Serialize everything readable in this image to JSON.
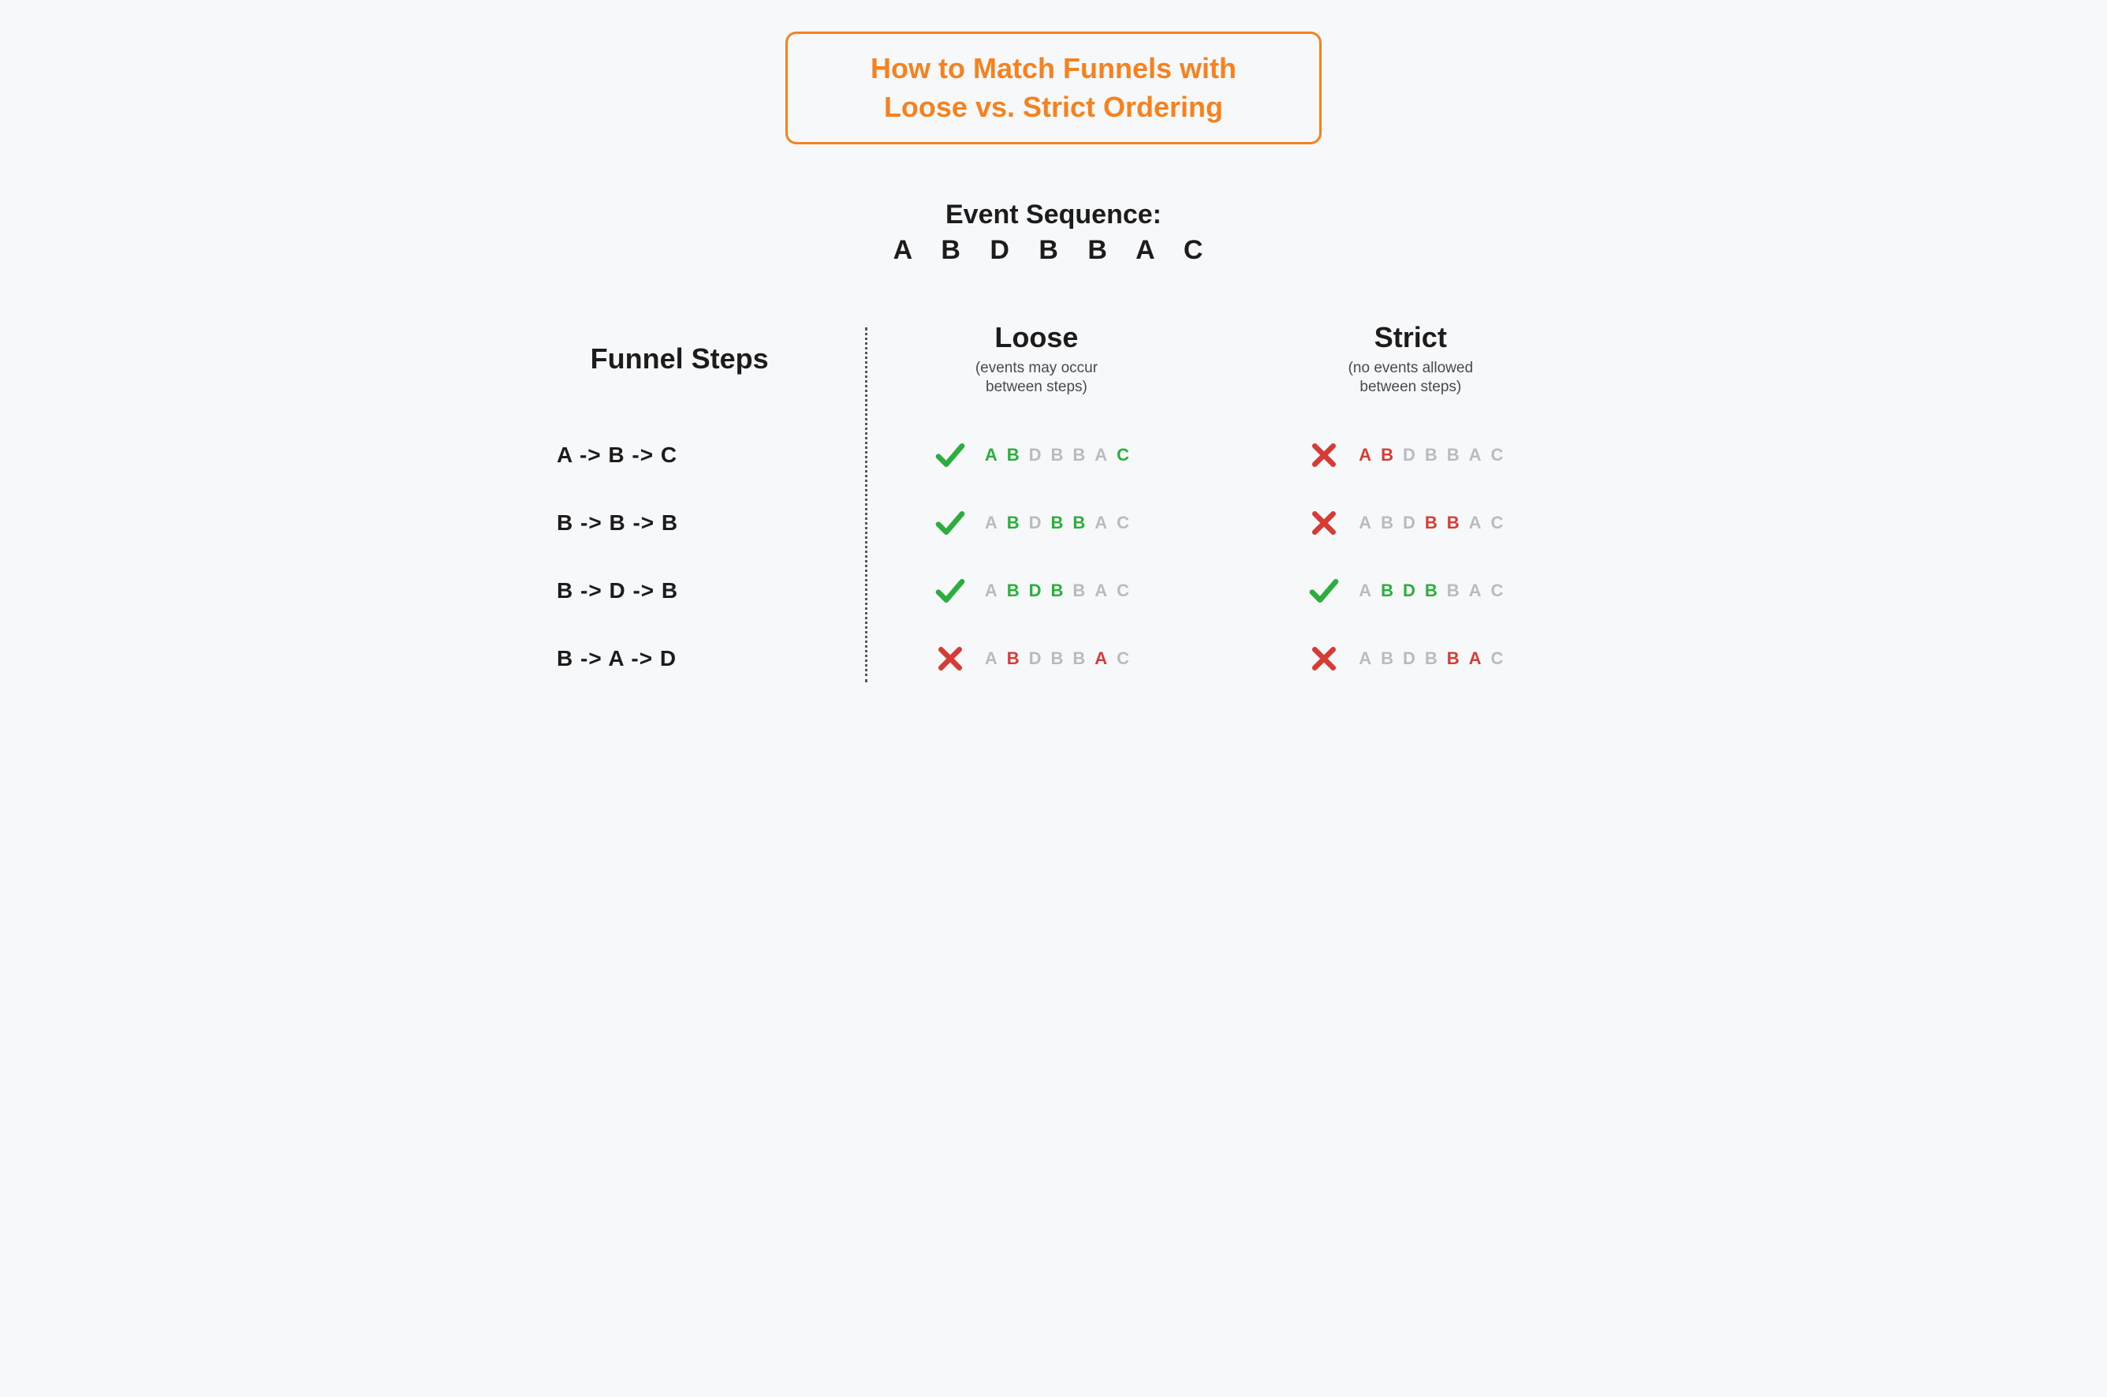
{
  "title": {
    "line1": "How to Match Funnels with",
    "line2": "Loose vs. Strict Ordering"
  },
  "event_sequence": {
    "label": "Event Sequence:",
    "value": "A B D B B A C"
  },
  "columns": {
    "funnel_steps": "Funnel Steps",
    "loose": {
      "heading": "Loose",
      "sub1": "(events may occur",
      "sub2": "between steps)"
    },
    "strict": {
      "heading": "Strict",
      "sub1": "(no events allowed",
      "sub2": "between steps)"
    }
  },
  "sequence_letters": [
    "A",
    "B",
    "D",
    "B",
    "B",
    "A",
    "C"
  ],
  "rows": [
    {
      "step": "A -> B -> C",
      "loose": {
        "result": "pass",
        "hl": [
          "g",
          "g",
          "m",
          "m",
          "m",
          "m",
          "g"
        ]
      },
      "strict": {
        "result": "fail",
        "hl": [
          "r",
          "r",
          "m",
          "m",
          "m",
          "m",
          "m"
        ]
      }
    },
    {
      "step": "B -> B -> B",
      "loose": {
        "result": "pass",
        "hl": [
          "m",
          "g",
          "m",
          "g",
          "g",
          "m",
          "m"
        ]
      },
      "strict": {
        "result": "fail",
        "hl": [
          "m",
          "m",
          "m",
          "r",
          "r",
          "m",
          "m"
        ]
      }
    },
    {
      "step": "B -> D -> B",
      "loose": {
        "result": "pass",
        "hl": [
          "m",
          "g",
          "g",
          "g",
          "m",
          "m",
          "m"
        ]
      },
      "strict": {
        "result": "pass",
        "hl": [
          "m",
          "g",
          "g",
          "g",
          "m",
          "m",
          "m"
        ]
      }
    },
    {
      "step": "B -> A -> D",
      "loose": {
        "result": "fail",
        "hl": [
          "m",
          "r",
          "m",
          "m",
          "m",
          "r",
          "m"
        ]
      },
      "strict": {
        "result": "fail",
        "hl": [
          "m",
          "m",
          "m",
          "m",
          "r",
          "r",
          "m"
        ]
      }
    }
  ],
  "icons": {
    "pass_label": "check-icon",
    "fail_label": "x-icon"
  }
}
